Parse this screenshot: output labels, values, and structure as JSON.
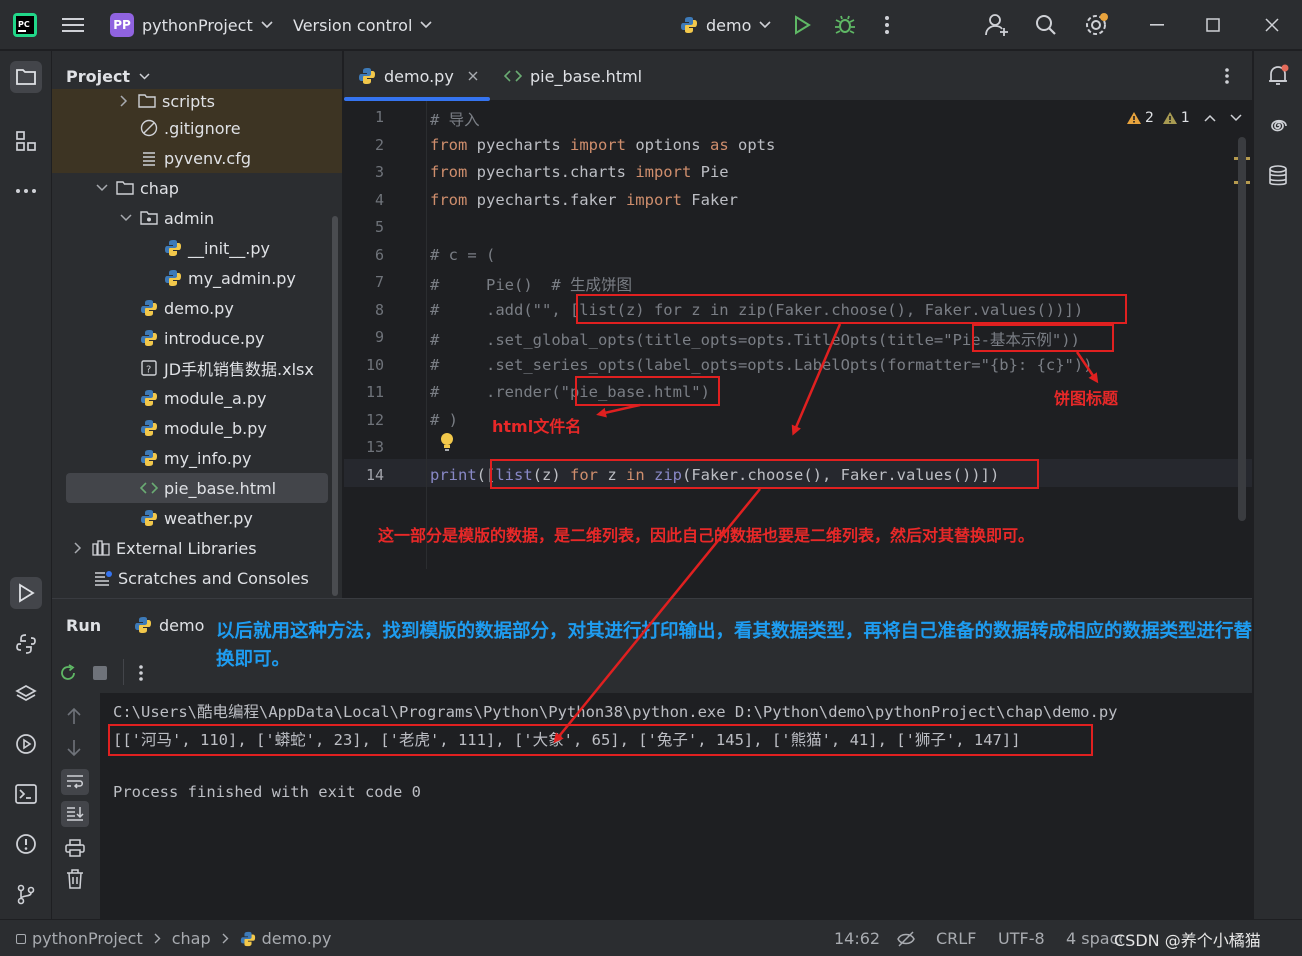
{
  "titlebar": {
    "project_badge": "PP",
    "project_name": "pythonProject",
    "vcs": "Version control",
    "run_config": "demo"
  },
  "project_panel": {
    "title": "Project",
    "items": [
      {
        "label": "scripts",
        "icon": "folder-icon"
      },
      {
        "label": ".gitignore",
        "icon": "ignore-file-icon"
      },
      {
        "label": "pyvenv.cfg",
        "icon": "config-file-icon"
      },
      {
        "label": "chap",
        "icon": "folder-icon"
      },
      {
        "label": "admin",
        "icon": "package-folder-icon"
      },
      {
        "label": "__init__.py",
        "icon": "python-file-icon"
      },
      {
        "label": "my_admin.py",
        "icon": "python-file-icon"
      },
      {
        "label": "demo.py",
        "icon": "python-file-icon"
      },
      {
        "label": "introduce.py",
        "icon": "python-file-icon"
      },
      {
        "label": "JD手机销售数据.xlsx",
        "icon": "unknown-file-icon"
      },
      {
        "label": "module_a.py",
        "icon": "python-file-icon"
      },
      {
        "label": "module_b.py",
        "icon": "python-file-icon"
      },
      {
        "label": "my_info.py",
        "icon": "python-file-icon"
      },
      {
        "label": "pie_base.html",
        "icon": "html-file-icon"
      },
      {
        "label": "weather.py",
        "icon": "python-file-icon"
      },
      {
        "label": "External Libraries",
        "icon": "library-icon"
      },
      {
        "label": "Scratches and Consoles",
        "icon": "scratches-icon"
      }
    ]
  },
  "editor": {
    "tabs": [
      {
        "label": "demo.py",
        "active": true
      },
      {
        "label": "pie_base.html",
        "active": false
      }
    ],
    "inspections": {
      "warnings": "2",
      "weak_warnings": "1"
    },
    "line_numbers": [
      "1",
      "2",
      "3",
      "4",
      "5",
      "6",
      "7",
      "8",
      "9",
      "10",
      "11",
      "12",
      "13",
      "14"
    ],
    "lines": [
      "# 导入",
      "from pyecharts import options as opts",
      "from pyecharts.charts import Pie",
      "from pyecharts.faker import Faker",
      "",
      "# c = (",
      "#     Pie()  # 生成饼图",
      "#     .add(\"\", [list(z) for z in zip(Faker.choose(), Faker.values())])",
      "#     .set_global_opts(title_opts=opts.TitleOpts(title=\"Pie-基本示例\"))",
      "#     .set_series_opts(label_opts=opts.LabelOpts(formatter=\"{b}: {c}\"))",
      "#     .render(\"pie_base.html\")",
      "# )",
      "",
      "print([list(z) for z in zip(Faker.choose(), Faker.values())])"
    ],
    "line14": {
      "print": "print",
      "open": "([",
      "list": "list",
      "a": "(z) ",
      "for": "for",
      "b": " z ",
      "in": "in",
      "c": " ",
      "zip": "zip",
      "d": "(Faker.choose(), Faker.values())])"
    }
  },
  "run_panel": {
    "title": "Run",
    "tab": "demo",
    "console": [
      "C:\\Users\\酷电编程\\AppData\\Local\\Programs\\Python\\Python38\\python.exe D:\\Python\\demo\\pythonProject\\chap\\demo.py",
      "[['河马', 110], ['蟒蛇', 23], ['老虎', 111], ['大象', 65], ['兔子', 145], ['熊猫', 41], ['狮子', 147]]",
      "",
      "Process finished with exit code 0"
    ]
  },
  "statusbar": {
    "breadcrumb": [
      "pythonProject",
      "chap",
      "demo.py"
    ],
    "position": "14:62",
    "line_sep": "CRLF",
    "encoding": "UTF-8",
    "indent": "4 spaces",
    "watermark": "CSDN @养个小橘猫"
  },
  "annotations": {
    "html_name": "html文件名",
    "pie_title": "饼图标题",
    "data_note": "这一部分是模版的数据，是二维列表，因此自己的数据也要是二维列表，然后对其替换即可。",
    "method_note": "以后就用这种方法，找到模版的数据部分，对其进行打印输出，看其数据类型，再将自己准备的数据转成相应的数据类型进行替换即可。"
  },
  "colors": {
    "accent": "#3574f0",
    "annotation_red": "#e02020",
    "annotation_blue": "#1e9cf0",
    "project_badge": "#9063e0"
  }
}
